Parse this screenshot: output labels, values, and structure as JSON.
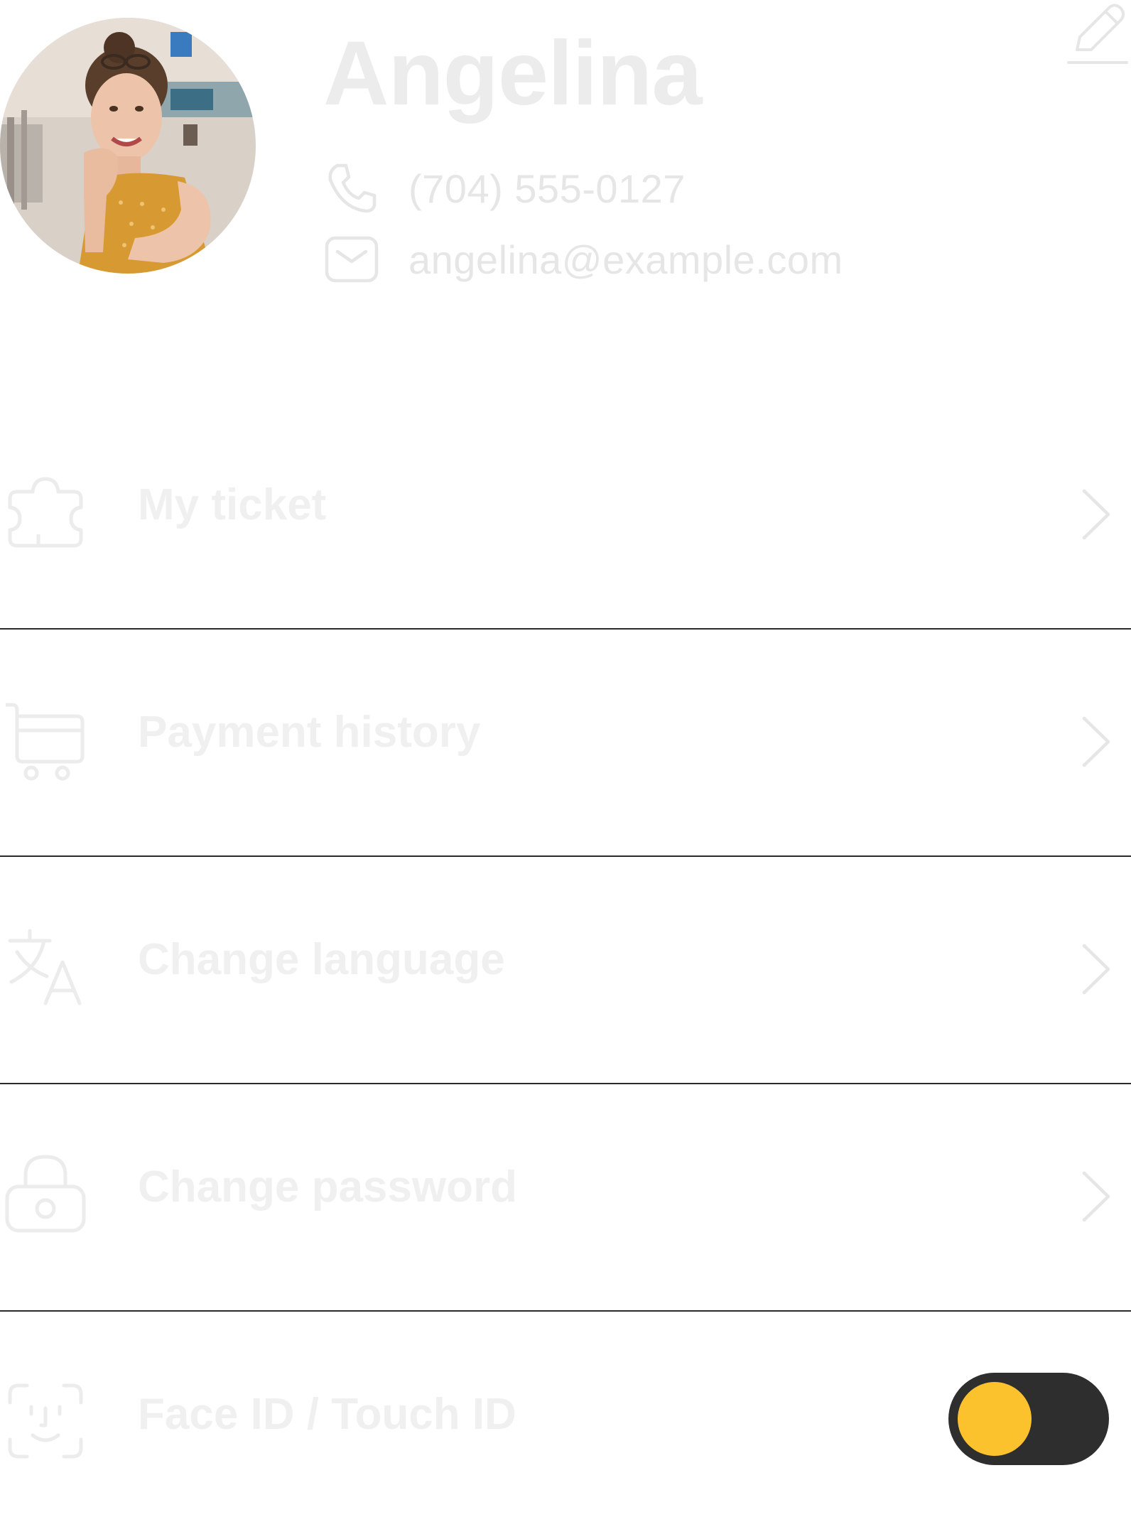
{
  "profile": {
    "name": "Angelina",
    "phone": "(704) 555-0127",
    "email": "angelina@example.com",
    "avatar_icon": "avatar-photo",
    "edit_icon": "pencil-icon",
    "phone_icon": "phone-icon",
    "email_icon": "mail-icon"
  },
  "menu": {
    "items": [
      {
        "label": "My ticket",
        "icon": "ticket-icon",
        "has_chevron": true
      },
      {
        "label": "Payment history",
        "icon": "cart-icon",
        "has_chevron": true
      },
      {
        "label": "Change language",
        "icon": "translate-icon",
        "has_chevron": true
      },
      {
        "label": "Change password",
        "icon": "lock-icon",
        "has_chevron": true
      },
      {
        "label": "Face ID / Touch ID",
        "icon": "face-id-icon",
        "toggle_on": false
      }
    ]
  },
  "colors": {
    "toggle_track": "#2e2e2e",
    "toggle_knob": "#fcc22e",
    "divider": "#2a2a2a",
    "muted_text": "#f0f0f0"
  }
}
